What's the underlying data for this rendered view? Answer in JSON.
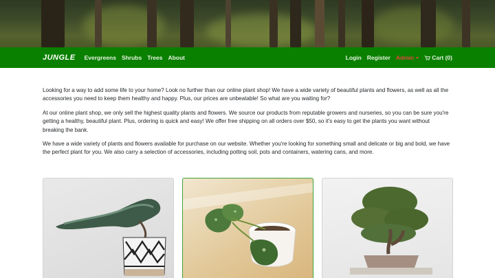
{
  "navbar": {
    "brand": "JUNGLE",
    "left_links": [
      "Evergreens",
      "Shrubs",
      "Trees",
      "About"
    ],
    "login": "Login",
    "register": "Register",
    "admin": "Admin",
    "cart": "Cart (0)"
  },
  "intro": {
    "paragraphs": [
      "Looking for a way to add some life to your home? Look no further than our online plant shop! We have a wide variety of beautiful plants and flowers, as well as all the accessories you need to keep them healthy and happy. Plus, our prices are unbeatable! So what are you waiting for?",
      "At our online plant shop, we only sell the highest quality plants and flowers. We source our products from reputable growers and nurseries, so you can be sure you're getting a healthy, beautiful plant. Plus, ordering is quick and easy! We offer free shipping on all orders over $50, so it's easy to get the plants you want without breaking the bank.",
      "We have a wide variety of plants and flowers available for purchase on our website. Whether you're looking for something small and delicate or big and bold, we have the perfect plant for you. We also carry a selection of accessories, including potting soil, pots and containers, watering cans, and more."
    ]
  },
  "products": [
    {
      "image": "juniper-bonsai-patterned-pot"
    },
    {
      "image": "pothos-in-white-cup"
    },
    {
      "image": "bonsai-tree"
    }
  ],
  "colors": {
    "navbar": "#0a8000",
    "admin_link": "#e0463c",
    "selected_card_border": "#3ea23a"
  },
  "icons": {
    "cart": "shopping-cart-icon",
    "admin_dropdown": "caret-down-icon"
  }
}
